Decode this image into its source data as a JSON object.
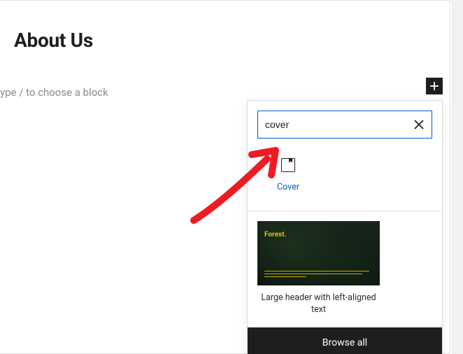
{
  "editor": {
    "page_title": "About Us",
    "placeholder": "ype / to choose a block"
  },
  "inserter": {
    "search_value": "cover",
    "block": {
      "label": "Cover",
      "icon": "cover-icon"
    },
    "pattern": {
      "thumb_label": "Forest.",
      "caption": "Large header with left-aligned text"
    },
    "browse_all": "Browse all"
  },
  "colors": {
    "accent": "#0a58ca",
    "dark": "#1e1e1e",
    "arrow": "#ed1c24"
  },
  "icons": {
    "plus": "plus-icon",
    "close": "close-icon",
    "cover": "cover-icon"
  }
}
